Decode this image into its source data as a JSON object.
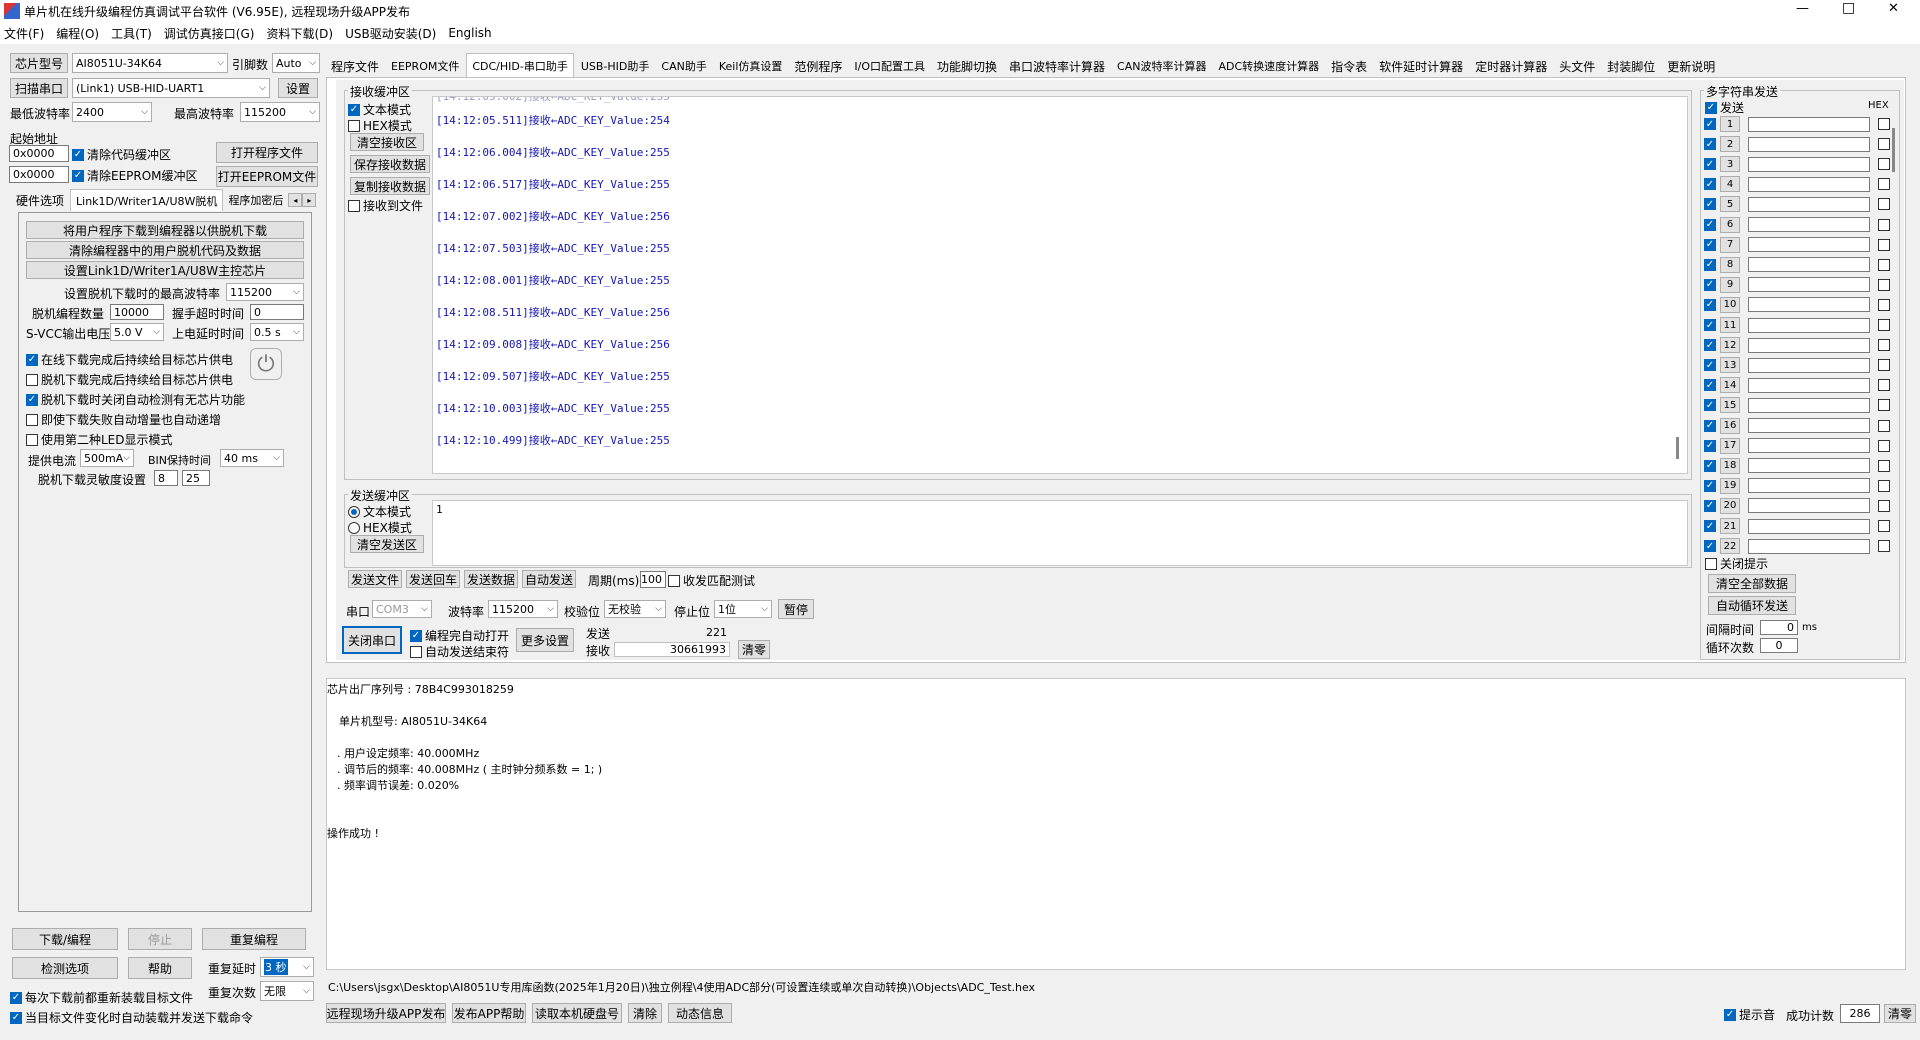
{
  "titlebar": {
    "title": "单片机在线升级编程仿真调试平台软件 (V6.95E), 远程现场升级APP发布",
    "min": "—",
    "max": "□",
    "close": "✕"
  },
  "menu": [
    "文件(F)",
    "编程(O)",
    "工具(T)",
    "调试仿真接口(G)",
    "资料下载(D)",
    "USB驱动安装(D)",
    "English"
  ],
  "left": {
    "chip_btn": "芯片型号",
    "chip_val": "AI8051U-34K64",
    "pin_lbl": "引脚数",
    "pin_val": "Auto",
    "scan_btn": "扫描串口",
    "port_val": "(Link1) USB-HID-UART1",
    "settings_btn": "设置",
    "min_baud_lbl": "最低波特率",
    "min_baud": "2400",
    "max_baud_lbl": "最高波特率",
    "max_baud": "115200",
    "start_addr_lbl": "起始地址",
    "addr1": "0x0000",
    "clear_code": "清除代码缓冲区",
    "open_prog": "打开程序文件",
    "addr2": "0x0000",
    "clear_eeprom": "清除EEPROM缓冲区",
    "open_eeprom": "打开EEPROM文件",
    "tabs": [
      "硬件选项",
      "Link1D/Writer1A/U8W脱机",
      "程序加密后"
    ],
    "b1": "将用户程序下载到编程器以供脱机下载",
    "b2": "清除编程器中的用户脱机代码及数据",
    "b3": "设置Link1D/Writer1A/U8W主控芯片",
    "max_offline_lbl": "设置脱机下载时的最高波特率",
    "max_offline": "115200",
    "count_lbl": "脱机编程数量",
    "count": "10000",
    "hs_lbl": "握手超时时间",
    "hs": "0",
    "svcc_lbl": "S-VCC输出电压",
    "svcc": "5.0 V",
    "pwr_lbl": "上电延时时间",
    "pwr": "0.5 s",
    "c1": "在线下载完成后持续给目标芯片供电",
    "c2": "脱机下载完成后持续给目标芯片供电",
    "c3": "脱机下载时关闭自动检测有无芯片功能",
    "c4": "即使下载失败自动增量也自动递增",
    "c5": "使用第二种LED显示模式",
    "cur_lbl": "提供电流",
    "cur": "500mA",
    "bin_lbl": "BIN保持时间",
    "bin": "40 ms",
    "sens_lbl": "脱机下载灵敏度设置",
    "sens1": "8",
    "sens2": "25",
    "download": "下载/编程",
    "stop": "停止",
    "redo": "重复编程",
    "detect": "检测选项",
    "help": "帮助",
    "rdelay_lbl": "重复延时",
    "rdelay": "3 秒",
    "rcount_lbl": "重复次数",
    "rcount": "无限",
    "c6": "每次下载前都重新装载目标文件",
    "c7": "当目标文件变化时自动装载并发送下载命令"
  },
  "tabs": [
    "程序文件",
    "EEPROM文件",
    "CDC/HID-串口助手",
    "USB-HID助手",
    "CAN助手",
    "Keil仿真设置",
    "范例程序",
    "I/O口配置工具",
    "功能脚切换",
    "串口波特率计算器",
    "CAN波特率计算器",
    "ADC转换速度计算器",
    "指令表",
    "软件延时计算器",
    "定时器计算器",
    "头文件",
    "封装脚位",
    "更新说明"
  ],
  "recv": {
    "title": "接收缓冲区",
    "text_mode": "文本模式",
    "hex_mode": "HEX模式",
    "clear": "清空接收区",
    "save": "保存接收数据",
    "copy": "复制接收数据",
    "to_file": "接收到文件",
    "lines": [
      "[14:12:05.511]接收←ADC_KEY_Value:254",
      "[14:12:06.004]接收←ADC_KEY_Value:255",
      "[14:12:06.517]接收←ADC_KEY_Value:255",
      "[14:12:07.002]接收←ADC_KEY_Value:256",
      "[14:12:07.503]接收←ADC_KEY_Value:255",
      "[14:12:08.001]接收←ADC_KEY_Value:255",
      "[14:12:08.511]接收←ADC_KEY_Value:256",
      "[14:12:09.008]接收←ADC_KEY_Value:256",
      "[14:12:09.507]接收←ADC_KEY_Value:255",
      "[14:12:10.003]接收←ADC_KEY_Value:255",
      "[14:12:10.499]接收←ADC_KEY_Value:255"
    ]
  },
  "send": {
    "title": "发送缓冲区",
    "text_mode": "文本模式",
    "hex_mode": "HEX模式",
    "clear": "清空发送区",
    "content": "1",
    "send_file": "发送文件",
    "send_enter": "发送回车",
    "send_data": "发送数据",
    "auto": "自动发送",
    "period_lbl": "周期(ms)",
    "period": "100",
    "match": "收发匹配测试"
  },
  "port": {
    "port_lbl": "串口",
    "port": "COM3",
    "baud_lbl": "波特率",
    "baud": "115200",
    "parity_lbl": "校验位",
    "parity": "无校验",
    "stop_lbl": "停止位",
    "stop": "1位",
    "pause": "暂停",
    "close": "关闭串口",
    "auto_open": "编程完自动打开",
    "auto_end": "自动发送结束符",
    "more": "更多设置",
    "tx_lbl": "发送",
    "tx": "221",
    "rx_lbl": "接收",
    "rx": "30661993",
    "clear": "清零"
  },
  "multi": {
    "title": "多字符串发送",
    "send": "发送",
    "hex": "HEX",
    "rows": [
      "1",
      "2",
      "3",
      "4",
      "5",
      "6",
      "7",
      "8",
      "9",
      "10",
      "11",
      "12",
      "13",
      "14",
      "15",
      "16",
      "17",
      "18",
      "19",
      "20",
      "21",
      "22"
    ],
    "close_hint": "关闭提示",
    "clear_all": "清空全部数据",
    "auto_loop": "自动循环发送",
    "interval_lbl": "间隔时间",
    "interval": "0",
    "ms": "ms",
    "loops_lbl": "循环次数",
    "loops": "0"
  },
  "log": [
    "芯片出厂序列号 : 78B4C993018259",
    "",
    "单片机型号: AI8051U-34K64",
    "",
    ". 用户设定频率: 40.000MHz",
    ". 调节后的频率: 40.008MHz ( 主时钟分频系数 = 1; )",
    ". 频率调节误差: 0.020%",
    "",
    "",
    "操作成功 !"
  ],
  "status": {
    "path": "C:\\Users\\jsgx\\Desktop\\AI8051U专用库函数(2025年1月20日)\\独立例程\\4使用ADC部分(可设置连续或单次自动转换)\\Objects\\ADC_Test.hex",
    "b1": "远程现场升级APP发布",
    "b2": "发布APP帮助",
    "b3": "读取本机硬盘号",
    "b4": "清除",
    "b5": "动态信息",
    "sound": "提示音",
    "succ_lbl": "成功计数",
    "succ": "286",
    "reset": "清零"
  }
}
